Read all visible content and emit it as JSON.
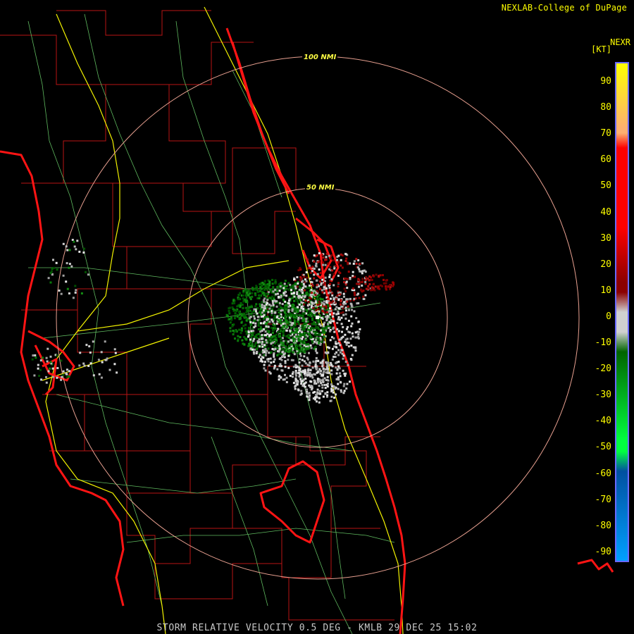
{
  "header": {
    "brand": "NEXLAB-College of DuPage",
    "product": "NEXR",
    "unit": "[KT]"
  },
  "rings": {
    "inner_label": "50 NMI",
    "outer_label": "100 NMI",
    "color": "#f0a0a0"
  },
  "legend": {
    "ticks": [
      "90",
      "80",
      "70",
      "60",
      "50",
      "40",
      "30",
      "20",
      "10",
      "0",
      "-10",
      "-20",
      "-30",
      "-40",
      "-50",
      "-60",
      "-70",
      "-80",
      "-90"
    ],
    "stops": [
      {
        "color": "#ffff00"
      },
      {
        "color": "#ffb070"
      },
      {
        "color": "#ff0000"
      },
      {
        "color": "#8b0000"
      },
      {
        "color": "#d0d0d0"
      },
      {
        "color": "#006400"
      },
      {
        "color": "#00ff40"
      },
      {
        "color": "#0050a0"
      },
      {
        "color": "#00a0ff"
      }
    ]
  },
  "map_colors": {
    "county_lines": "#c01818",
    "coastline": "#ff1a1a",
    "highways": "#f0f000",
    "roads": "#60c060",
    "radar_site": "KMLB"
  },
  "footer": {
    "caption": "STORM RELATIVE VELOCITY 0.5 DEG - KMLB 29 DEC 25 15:02"
  }
}
